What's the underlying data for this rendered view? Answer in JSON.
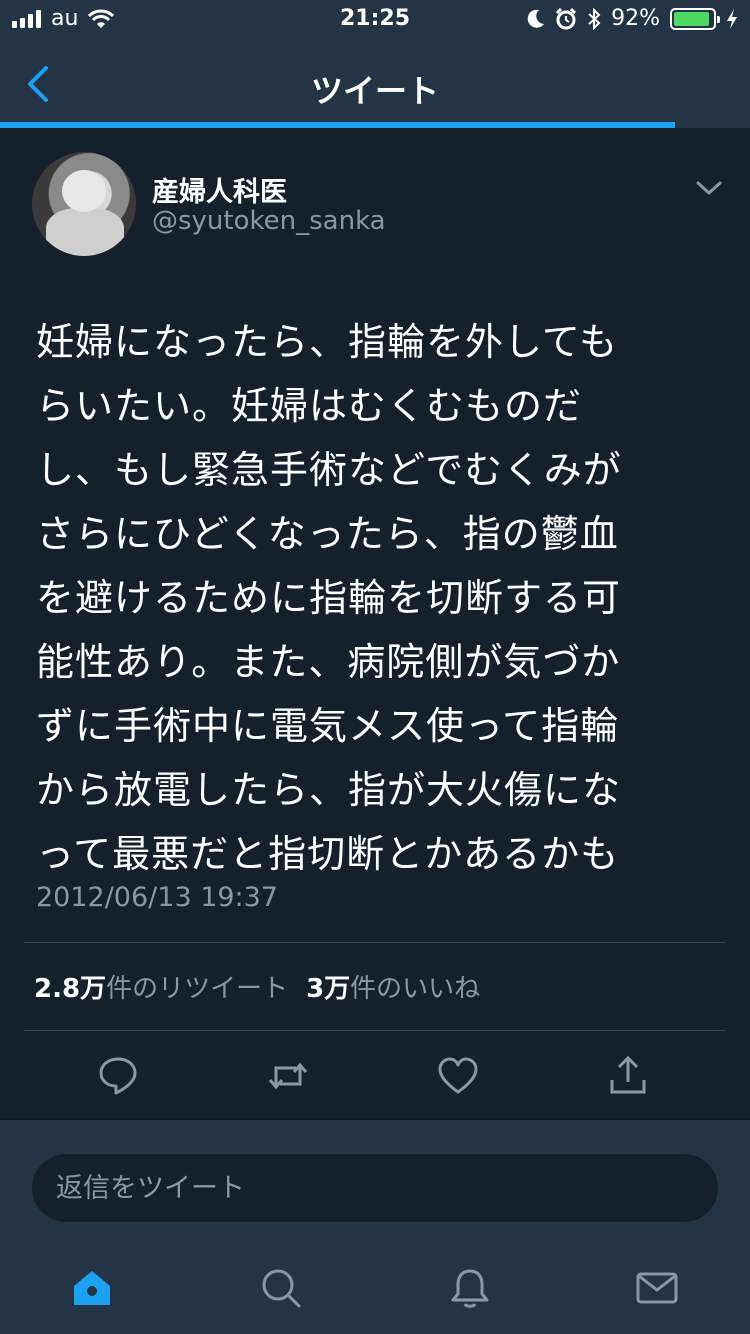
{
  "status_bar": {
    "carrier": "au",
    "time": "21:25",
    "battery_percent": "92%",
    "battery_level": 0.92
  },
  "nav": {
    "title": "ツイート"
  },
  "progress": {
    "fraction": 0.9
  },
  "tweet": {
    "display_name": "産婦人科医",
    "handle": "@syutoken_sanka",
    "lines": [
      "妊婦になったら、指輪を外しても",
      "らいたい。妊婦はむくむものだ",
      "し、もし緊急手術などでむくみが",
      "さらにひどくなったら、指の鬱血",
      "を避けるために指輪を切断する可",
      "能性あり。また、病院側が気づか",
      "ずに手術中に電気メス使って指輪",
      "から放電したら、指が大火傷にな",
      "って最悪だと指切断とかあるかも"
    ],
    "timestamp": "2012/06/13 19:37",
    "retweet_count": "2.8万",
    "retweet_label": "件のリツイート",
    "like_count": "3万",
    "like_label": "件のいいね"
  },
  "actions": [
    "reply-icon",
    "retweet-icon",
    "like-icon",
    "share-icon"
  ],
  "reply": {
    "placeholder": "返信をツイート"
  },
  "tabbar": [
    "home-icon",
    "search-icon",
    "notifications-icon",
    "messages-icon"
  ],
  "colors": {
    "accent": "#1da1f2",
    "background": "#15202b",
    "bar": "#243447",
    "secondary_text": "#8899a6",
    "battery": "#4cd964"
  }
}
